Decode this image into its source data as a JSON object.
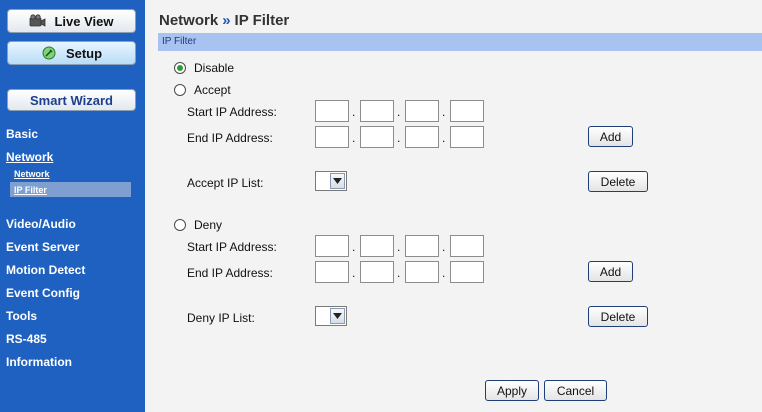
{
  "sidebar": {
    "live_view": "Live View",
    "setup": "Setup",
    "smart_wizard": "Smart Wizard",
    "items": [
      {
        "label": "Basic"
      },
      {
        "label": "Network"
      },
      {
        "label": "Video/Audio"
      },
      {
        "label": "Event Server"
      },
      {
        "label": "Motion Detect"
      },
      {
        "label": "Event Config"
      },
      {
        "label": "Tools"
      },
      {
        "label": "RS-485"
      },
      {
        "label": "Information"
      }
    ],
    "sub_items": [
      {
        "label": "Network"
      },
      {
        "label": "IP Filter"
      }
    ],
    "icons": {
      "live_view": "camera-icon",
      "setup": "wrench-icon"
    }
  },
  "header": {
    "breadcrumb_parent": "Network",
    "separator": "»",
    "breadcrumb_current": "IP Filter",
    "section_title": "IP Filter"
  },
  "options": {
    "disable": "Disable",
    "accept": "Accept",
    "deny": "Deny",
    "selected": "Disable"
  },
  "accept": {
    "start_label": "Start IP Address:",
    "end_label": "End IP Address:",
    "list_label": "Accept IP List:",
    "add_label": "Add",
    "delete_label": "Delete"
  },
  "deny": {
    "start_label": "Start IP Address:",
    "end_label": "End IP Address:",
    "list_label": "Deny IP List:",
    "add_label": "Add",
    "delete_label": "Delete"
  },
  "ip_separator": ".",
  "footer": {
    "apply_label": "Apply",
    "cancel_label": "Cancel"
  },
  "colors": {
    "sidebar_bg": "#1f61c0",
    "section_bar": "#a9c3f1",
    "active_sub_item": "#7f9fd0"
  }
}
